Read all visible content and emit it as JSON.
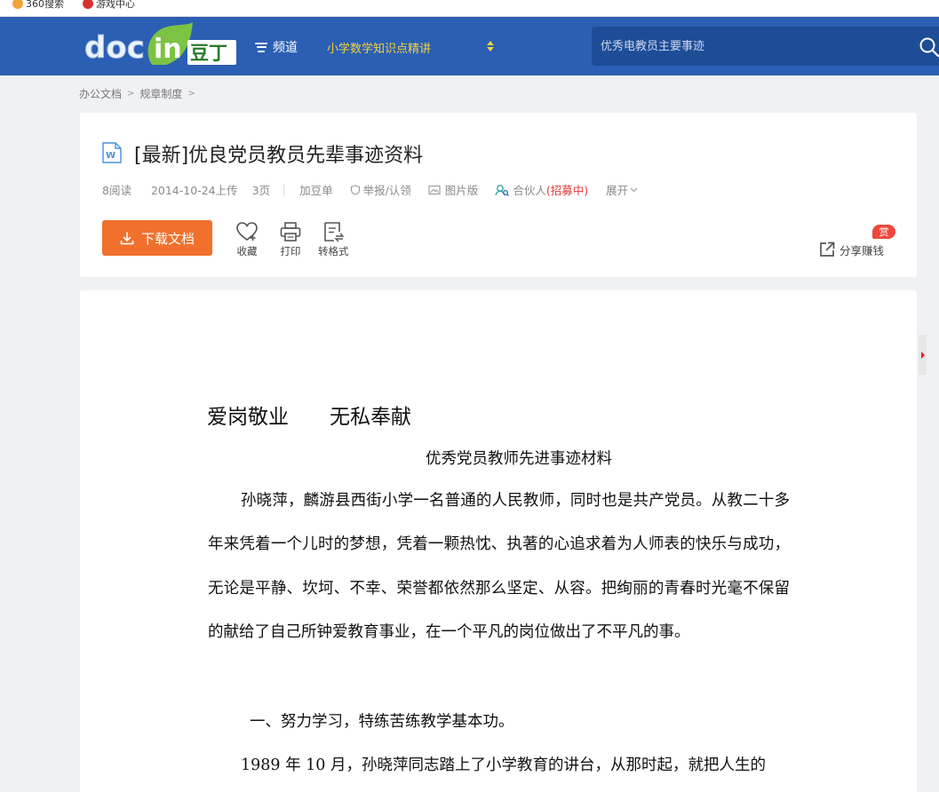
{
  "browser": {
    "bookmarks": [
      {
        "label": "360搜索",
        "color": "#f2a33a"
      },
      {
        "label": "游戏中心",
        "color": "#d9302c"
      }
    ]
  },
  "header": {
    "logo_text": "docin豆丁",
    "channel_label": "频道",
    "promo_text": "小学数学知识点精讲",
    "search_placeholder": "优秀电教员主要事迹"
  },
  "breadcrumb": [
    "办公文档",
    "规章制度"
  ],
  "document": {
    "title": "[最新]优良党员教员先辈事迹资料",
    "meta": {
      "reads": "8阅读",
      "upload_date": "2014-10-24上传",
      "pages": "3页",
      "add_list": "加豆单",
      "report": "举报/认领",
      "image_version": "图片版",
      "partner": "合伙人",
      "recruiting": "(招募中)",
      "expand": "展开"
    },
    "actions": {
      "download": "下载文档",
      "favorite": "收藏",
      "print": "打印",
      "convert": "转格式",
      "share": "分享赚钱",
      "reward_badge": "赏"
    }
  },
  "page_content": {
    "heading": "爱岗敬业　　无私奉献",
    "subtitle": "优秀党员教师先进事迹材料",
    "paragraph1": "孙晓萍，麟游县西街小学一名普通的人民教师，同时也是共产党员。从教二十多年来凭着一个儿时的梦想，凭着一颗热忱、执著的心追求着为人师表的快乐与成功，无论是平静、坎坷、不幸、荣誉都依然那么坚定、从容。把绚丽的青春时光毫不保留的献给了自己所钟爱教育事业，在一个平凡的岗位做出了不平凡的事。",
    "section1": "一、努力学习，特练苦练教学基本功。",
    "paragraph2_start": "1989 年 10 月，孙晓萍同志踏上了小学教育的讲台，从那时起，就把人生的"
  },
  "colors": {
    "header_bg": "#2a5fb4",
    "search_bg": "#1e4d97",
    "promo": "#f5d13a",
    "download_btn": "#f0702c",
    "recruit": "#e53939"
  }
}
